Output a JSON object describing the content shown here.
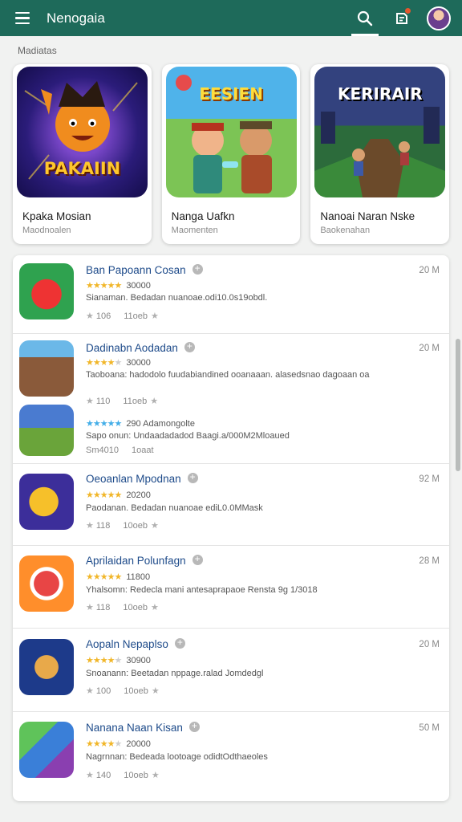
{
  "header": {
    "title": "Nenogaia",
    "icons": [
      "menu-icon",
      "search-icon",
      "notification-icon",
      "avatar"
    ]
  },
  "section": {
    "label": "Madiatas"
  },
  "featured": [
    {
      "art_text": "PAKAIIN",
      "title": "Kpaka Mosian",
      "subtitle": "Maodnoalen",
      "accent": "#2b1c7a"
    },
    {
      "art_text": "EESIEN",
      "title": "Nanga Uafkn",
      "subtitle": "Maomenten",
      "accent": "#4fb3ea"
    },
    {
      "art_text": "KERIRAIR",
      "title": "Nanoai Naran Nske",
      "subtitle": "Baokenahan",
      "accent": "#33427e"
    }
  ],
  "apps": [
    {
      "title": "Ban Papoann Cosan",
      "size": "20 M",
      "rating_stars": 5,
      "rating_text": "30000",
      "description": "Sianaman. Bedadan nuanoae.odi10.0s19obdl.",
      "meta_a": "106",
      "meta_b": "11oeb",
      "art_color": "#2fa24f"
    },
    {
      "title": "Dadinabn Aodadan",
      "size": "20 M",
      "rating_stars": 4,
      "rating_text": "30000",
      "description": "Taoboana: hadodolo fuudabiandined ooanaaan. alasedsnao dagoaan oa",
      "meta_a": "110",
      "meta_b": "11oeb",
      "art_color": "#2c5fa8",
      "sub": {
        "rating_stars": 5,
        "rating_text": "290 Adamongolte",
        "description": "Sapo onun: Undaadadadod Baagi.a/000M2Mloaued",
        "meta_a": "Sm4010",
        "meta_b": "1oaat",
        "art_color": "#6aa43a"
      }
    },
    {
      "title": "Oeoanlan Mpodnan",
      "size": "92 M",
      "rating_stars": 5,
      "rating_text": "20200",
      "description": "Paodanan. Bedadan nuanoae ediL0.0MMask",
      "meta_a": "118",
      "meta_b": "10oeb",
      "art_color": "#3c2e9a"
    },
    {
      "title": "Aprilaidan Polunfagn",
      "size": "28 M",
      "rating_stars": 5,
      "rating_text": "11800",
      "description": "Yhalsomn: Redecla mani antesaprapaoe Rensta 9g 1/3018",
      "meta_a": "118",
      "meta_b": "10oeb",
      "art_color": "#ff8e2b"
    },
    {
      "title": "Aopaln Nepaplso",
      "size": "20 M",
      "rating_stars": 4,
      "rating_text": "30900",
      "description": "Snoanann: Beetadan nppage.ralad Jomdedgl",
      "meta_a": "100",
      "meta_b": "10oeb",
      "art_color": "#1d3a8a"
    },
    {
      "title": "Nanana Naan Kisan",
      "size": "50 M",
      "rating_stars": 4,
      "rating_text": "20000",
      "description": "Nagrnnan: Bedeada lootoage odidtOdthaeoles",
      "meta_a": "140",
      "meta_b": "10oeb",
      "art_color": "#4c8e3a"
    }
  ]
}
